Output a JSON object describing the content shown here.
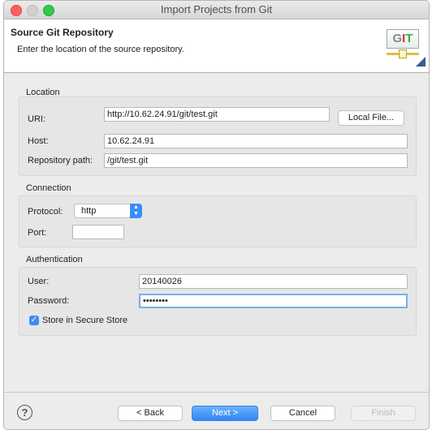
{
  "window": {
    "title": "Import Projects from Git"
  },
  "header": {
    "title": "Source Git Repository",
    "description": "Enter the location of the source repository.",
    "icon_text": "GIT"
  },
  "location": {
    "label": "Location",
    "uri_label": "URI:",
    "uri_value": "http://10.62.24.91/git/test.git",
    "local_file_button": "Local File...",
    "host_label": "Host:",
    "host_value": "10.62.24.91",
    "path_label": "Repository path:",
    "path_value": "/git/test.git"
  },
  "connection": {
    "label": "Connection",
    "protocol_label": "Protocol:",
    "protocol_value": "http",
    "port_label": "Port:",
    "port_value": ""
  },
  "authentication": {
    "label": "Authentication",
    "user_label": "User:",
    "user_value": "20140026",
    "password_label": "Password:",
    "password_value": "••••••••",
    "store_label": "Store in Secure Store",
    "store_checked": true
  },
  "footer": {
    "back": "< Back",
    "next": "Next >",
    "cancel": "Cancel",
    "finish": "Finish",
    "help_icon": "?"
  },
  "colors": {
    "accent": "#3b8ef5",
    "close": "#fc605c",
    "minimize": "#cfcfcf",
    "zoom": "#34c84a"
  }
}
